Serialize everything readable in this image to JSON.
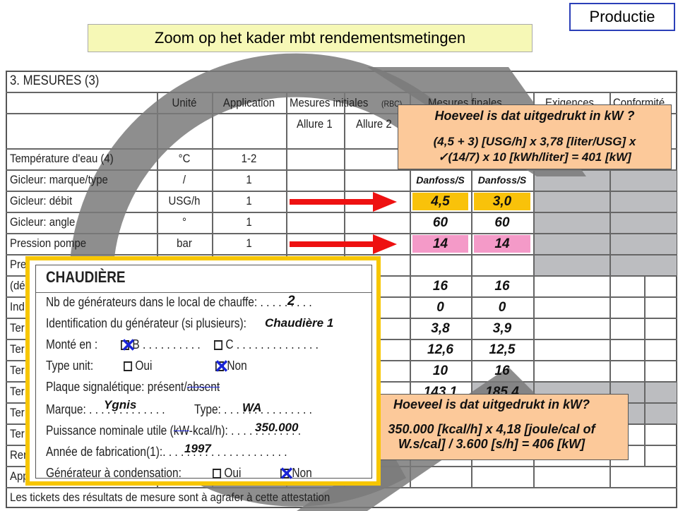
{
  "slide": {
    "title": "Zoom op het kader mbt rendementsmetingen",
    "tag": "Productie"
  },
  "form": {
    "section_title": "3. MESURES (3)",
    "headers": {
      "unite": "Unité",
      "application": "Application",
      "initiales": "Mesures initiales",
      "initiales_note": "(RBC)",
      "finales": "Mesures finales",
      "exigences": "Exigences",
      "conformite": "Conformité",
      "allure1": "Allure 1",
      "allure2": "Allure 2"
    },
    "rows": [
      {
        "label": "Température d'eau (4)",
        "unit": "°C",
        "app": "1-2",
        "f1": "",
        "f2": ""
      },
      {
        "label": "Gicleur: marque/type",
        "unit": "/",
        "app": "1",
        "f1": "Danfoss/S",
        "f2": "Danfoss/S"
      },
      {
        "label": "Gicleur: débit",
        "unit": "USG/h",
        "app": "1",
        "f1": "4,5",
        "f2": "3,0"
      },
      {
        "label": "Gicleur: angle",
        "unit": "°",
        "app": "1",
        "f1": "60",
        "f2": "60"
      },
      {
        "label": "Pression pompe",
        "unit": "bar",
        "app": "1",
        "f1": "14",
        "f2": "14"
      },
      {
        "label": "Pre",
        "f1": "",
        "f2": ""
      },
      {
        "label": "(dé",
        "f1": "16",
        "f2": "16"
      },
      {
        "label": "Ind",
        "f1": "0",
        "f2": "0"
      },
      {
        "label": "Ter",
        "f1": "3,8",
        "f2": "3,9"
      },
      {
        "label": "Ter",
        "f1": "12,6",
        "f2": "12,5"
      },
      {
        "label": "Ter",
        "f1": "10",
        "f2": "16"
      },
      {
        "label": "Ter",
        "f1": "143,1",
        "f2": "185,4"
      },
      {
        "label": "Ter"
      },
      {
        "label": "Ter"
      },
      {
        "label": "Rer"
      },
      {
        "label": "App"
      }
    ],
    "footer": "Les tickets des résultats de mesure sont à agrafer à cette attestation"
  },
  "colors": {
    "debit_highlight": "#f9c20a",
    "pression_highlight": "#f49ac8",
    "callout": "#fcc99a",
    "frame": "#f7c600",
    "arrow": "#ee1111",
    "checkmark": "#1a25d8"
  },
  "callout_top": {
    "title": "Hoeveel is dat uitgedrukt in kW ?",
    "line1": "(4,5 + 3) [USG/h] x 3,78 [liter/USG] x",
    "line2": "✓(14/7) x 10 [kWh/liter] = 401 [kW]"
  },
  "callout_bottom": {
    "title": "Hoeveel is dat uitgedrukt in kW?",
    "line1": "350.000 [kcal/h] x 4,18 [joule/cal of",
    "line2": "W.s/cal] / 3.600 [s/h] = 406 [kW]"
  },
  "chaudiere": {
    "title": "CHAUDIÈRE",
    "nb_label": "Nb de générateurs dans le local de chauffe: . . . . . . . . .",
    "nb_value": "2",
    "id_label": "Identification du générateur (si plusieurs):",
    "id_value": "Chaudière 1",
    "monte_label": "Monté en :",
    "monte_b": "B . . . . . . . . . .",
    "monte_c": "C . . . . . . . . . . . . . .",
    "type_label": "Type unit:",
    "oui": "Oui",
    "non": "Non",
    "plaque_label": "Plaque signalétique:  présent/",
    "plaque_struck": "absent",
    "marque_label": "Marque: . . . . . . . . . . . . .",
    "marque_value": "Ygnis",
    "type2_label": "Type: . . . . . . . . . . . . . . .",
    "type2_value": "WA",
    "puissance_label": "Puissance nominale utile (",
    "puissance_struck": "kW",
    "puissance_label2": "-kcal/h): . . . . . . . . . . . .",
    "puissance_value": "350.000",
    "annee_label": "Année de fabrication(1):. . . . . . . . . . . . . . . . . . . . .",
    "annee_value": "1997",
    "cond_label": "Générateur à condensation:"
  }
}
